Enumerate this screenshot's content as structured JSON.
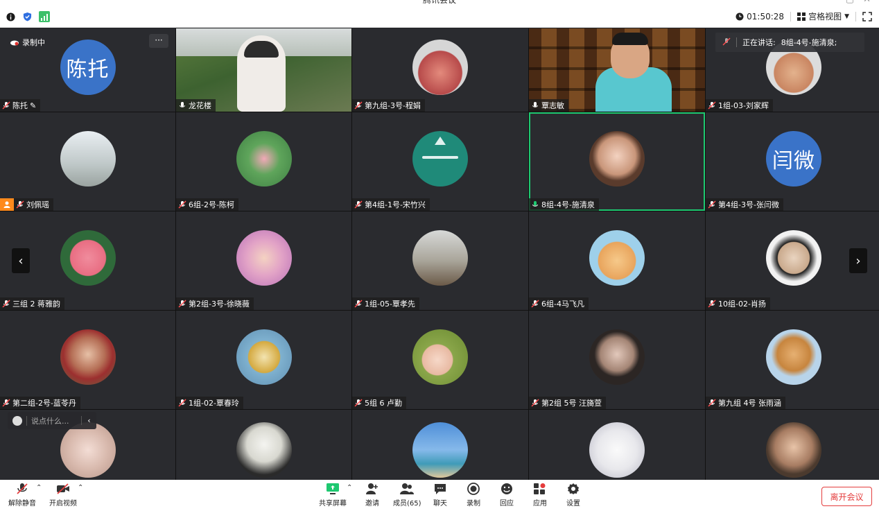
{
  "window": {
    "title": "腾讯会议"
  },
  "header": {
    "time": "01:50:28",
    "view_mode": "宫格视图"
  },
  "recording_label": "录制中",
  "more_label": "···",
  "speaking": {
    "label": "正在讲话:",
    "name": "8组-4号-施清泉;"
  },
  "participants": [
    {
      "name": "陈托",
      "avatar_text": "陈托"
    },
    {
      "name": "龙花楼"
    },
    {
      "name": "第九组-3号-程娟"
    },
    {
      "name": "覃志敏"
    },
    {
      "name": "1组-03-刘家辉"
    },
    {
      "name": "刘佩瑶"
    },
    {
      "name": "6组-2号-陈柯"
    },
    {
      "name": "第4组-1号-宋竹兴"
    },
    {
      "name": "8组-4号-施清泉"
    },
    {
      "name": "第4组-3号-张闫微",
      "avatar_text": "闫微"
    },
    {
      "name": "三组 2 蒋雅韵"
    },
    {
      "name": "第2组-3号-徐晓薇"
    },
    {
      "name": "1组-05-覃孝先"
    },
    {
      "name": "6组-4马飞凡"
    },
    {
      "name": "10组-02-肖扬"
    },
    {
      "name": "第二组-2号-蓝苓丹"
    },
    {
      "name": "1组-02-覃春玲"
    },
    {
      "name": "5组 6 卢勤"
    },
    {
      "name": "第2组 5号 汪旖萱"
    },
    {
      "name": "第九组 4号 张雨涵"
    }
  ],
  "chat": {
    "placeholder": "说点什么..."
  },
  "toolbar": {
    "mute": "解除静音",
    "video": "开启视频",
    "share": "共享屏幕",
    "invite": "邀请",
    "members": "成员(65)",
    "chat": "聊天",
    "record": "录制",
    "react": "回应",
    "apps": "应用",
    "settings": "设置",
    "leave": "离开会议"
  },
  "colors": {
    "accent_green": "#1ec870",
    "leave_red": "#e43c3c",
    "avatar_blue": "#3a73c8",
    "recording_red": "#e0322f"
  }
}
